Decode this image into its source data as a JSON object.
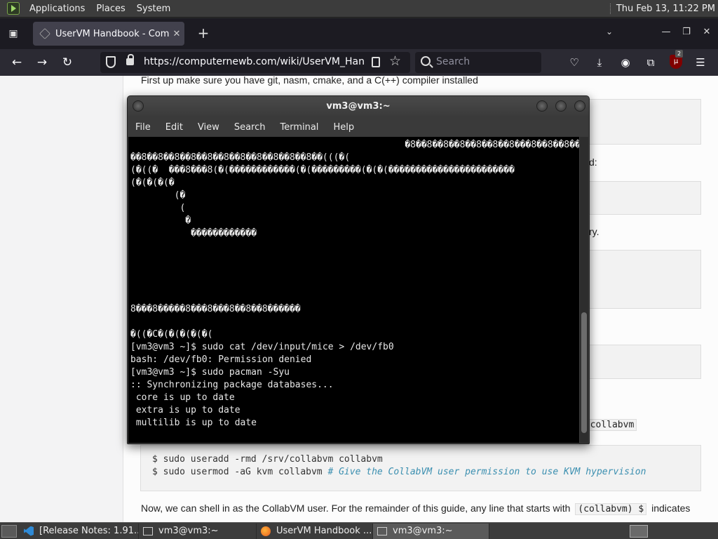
{
  "top_panel": {
    "menus": [
      "Applications",
      "Places",
      "System"
    ],
    "clock": "Thu Feb 13, 11:22 PM"
  },
  "browser": {
    "tab_title": "UserVM Handbook - Compu",
    "url": "https://computernewb.com/wiki/UserVM_Handbook",
    "search_placeholder": "Search",
    "extension_badge": "2"
  },
  "page": {
    "intro": "First up make sure you have git, nasm, cmake, and a C(++) compiler installed",
    "frag_d": "d:",
    "frag_ry": "ry.",
    "inline_code_collabvm": "v/collabvm",
    "code_line1": "$ sudo useradd -rmd /srv/collabvm collabvm",
    "code_line2_cmd": "$ sudo usermod -aG kvm collabvm ",
    "code_line2_comment": "# Give the CollabVM user permission to use KVM hypervision",
    "para2_start": "Now, we can shell in as the CollabVM user. For the remainder of this guide, any line that starts with",
    "para2_code": "(collabvm) $",
    "para2_end": "indicates"
  },
  "terminal": {
    "title": "vm3@vm3:~",
    "menu": [
      "File",
      "Edit",
      "View",
      "Search",
      "Terminal",
      "Help"
    ],
    "lines": [
      "                                                  �8��8��8��8��8��8��8���8��8��8��8��8��8",
      "��8��8��8��8��8��8��8��8��8��8��8��(((�(",
      "(�((�  ���8���8(�(������������(�(���������(�(�(�����������������������",
      "(�(�(�(�",
      "        (�",
      "         (",
      "          �",
      "           ������������",
      "",
      "",
      "",
      "",
      "",
      "8���8�����8���8���8��8��8������",
      "",
      "�((�C�(�(�(�(�(",
      "[vm3@vm3 ~]$ sudo cat /dev/input/mice > /dev/fb0",
      "bash: /dev/fb0: Permission denied",
      "[vm3@vm3 ~]$ sudo pacman -Syu",
      ":: Synchronizing package databases...",
      " core is up to date",
      " extra is up to date",
      " multilib is up to date"
    ]
  },
  "taskbar": {
    "tasks": [
      "[Release Notes: 1.91...",
      "vm3@vm3:~",
      "UserVM Handbook ...",
      "vm3@vm3:~"
    ]
  }
}
